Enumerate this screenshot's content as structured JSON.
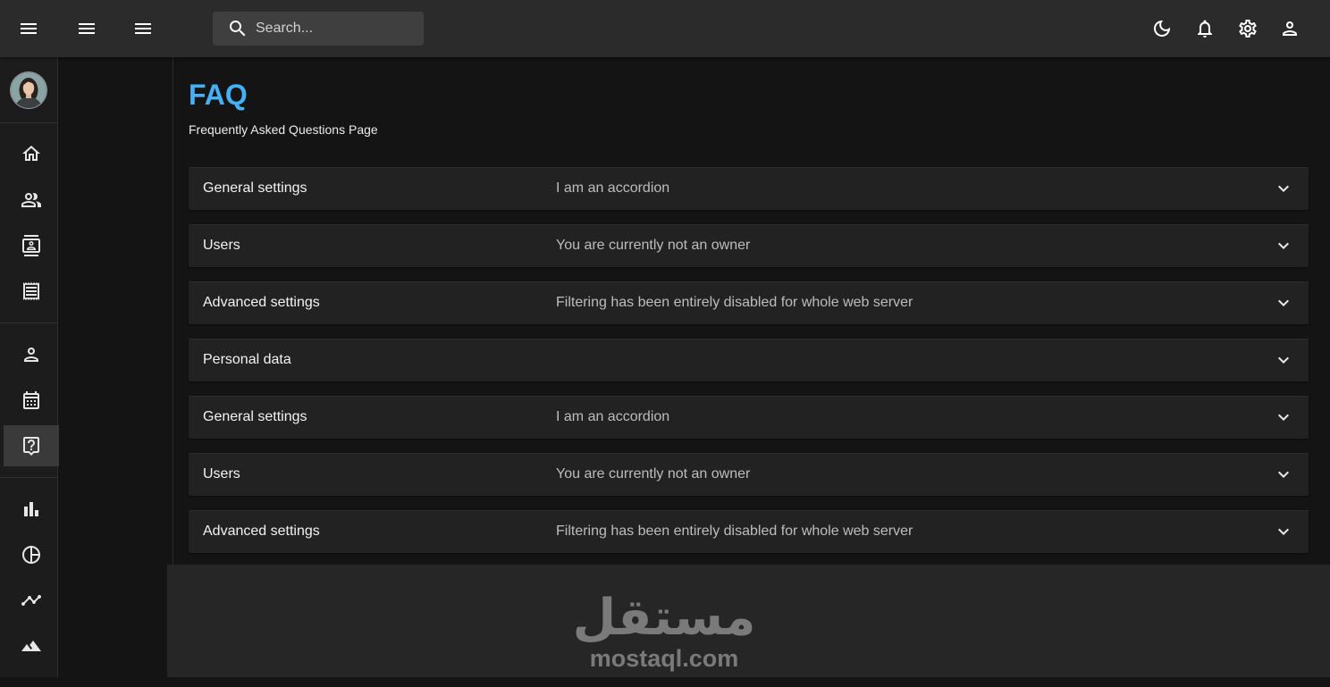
{
  "topbar": {
    "menu_buttons": [
      {
        "icon": "menu-icon"
      },
      {
        "icon": "menu-icon"
      },
      {
        "icon": "menu-icon"
      }
    ],
    "search": {
      "placeholder": "Search...",
      "icon": "search-icon"
    },
    "actions": [
      {
        "icon": "dark-mode-icon"
      },
      {
        "icon": "notifications-icon"
      },
      {
        "icon": "settings-icon"
      },
      {
        "icon": "account-icon"
      }
    ]
  },
  "sidebar": {
    "avatar": {
      "icon": "avatar-icon"
    },
    "groups": [
      {
        "items": [
          {
            "icon": "home-icon"
          },
          {
            "icon": "people-icon"
          },
          {
            "icon": "contacts-icon"
          },
          {
            "icon": "receipt-icon"
          }
        ]
      },
      {
        "items": [
          {
            "icon": "person-icon"
          },
          {
            "icon": "calendar-icon"
          },
          {
            "icon": "help-icon",
            "active": true
          }
        ]
      },
      {
        "items": [
          {
            "icon": "bar-chart-icon"
          },
          {
            "icon": "pie-chart-icon"
          },
          {
            "icon": "timeline-icon"
          },
          {
            "icon": "terrain-icon"
          }
        ]
      }
    ]
  },
  "page": {
    "title": "FAQ",
    "subtitle": "Frequently Asked Questions Page"
  },
  "faq": {
    "expand_icon": "chevron-down-icon",
    "items": [
      {
        "title": "General settings",
        "summary": "I am an accordion"
      },
      {
        "title": "Users",
        "summary": "You are currently not an owner"
      },
      {
        "title": "Advanced settings",
        "summary": "Filtering has been entirely disabled for whole web server"
      },
      {
        "title": "Personal data"
      },
      {
        "title": "General settings",
        "summary": "I am an accordion"
      },
      {
        "title": "Users",
        "summary": "You are currently not an owner"
      },
      {
        "title": "Advanced settings",
        "summary": "Filtering has been entirely disabled for whole web server"
      }
    ]
  },
  "footer": {
    "logo_arabic": "مستقل",
    "logo_latin": "mostaql.com"
  },
  "colors": {
    "accent": "#47b0f5",
    "topbar": "#2b2b2b",
    "sidebar": "#1c1c1c",
    "background": "#141414",
    "accordion": "#222222",
    "footer": "#262626",
    "active_item": "#3a3a3a",
    "logo": "#7a7a7a"
  }
}
